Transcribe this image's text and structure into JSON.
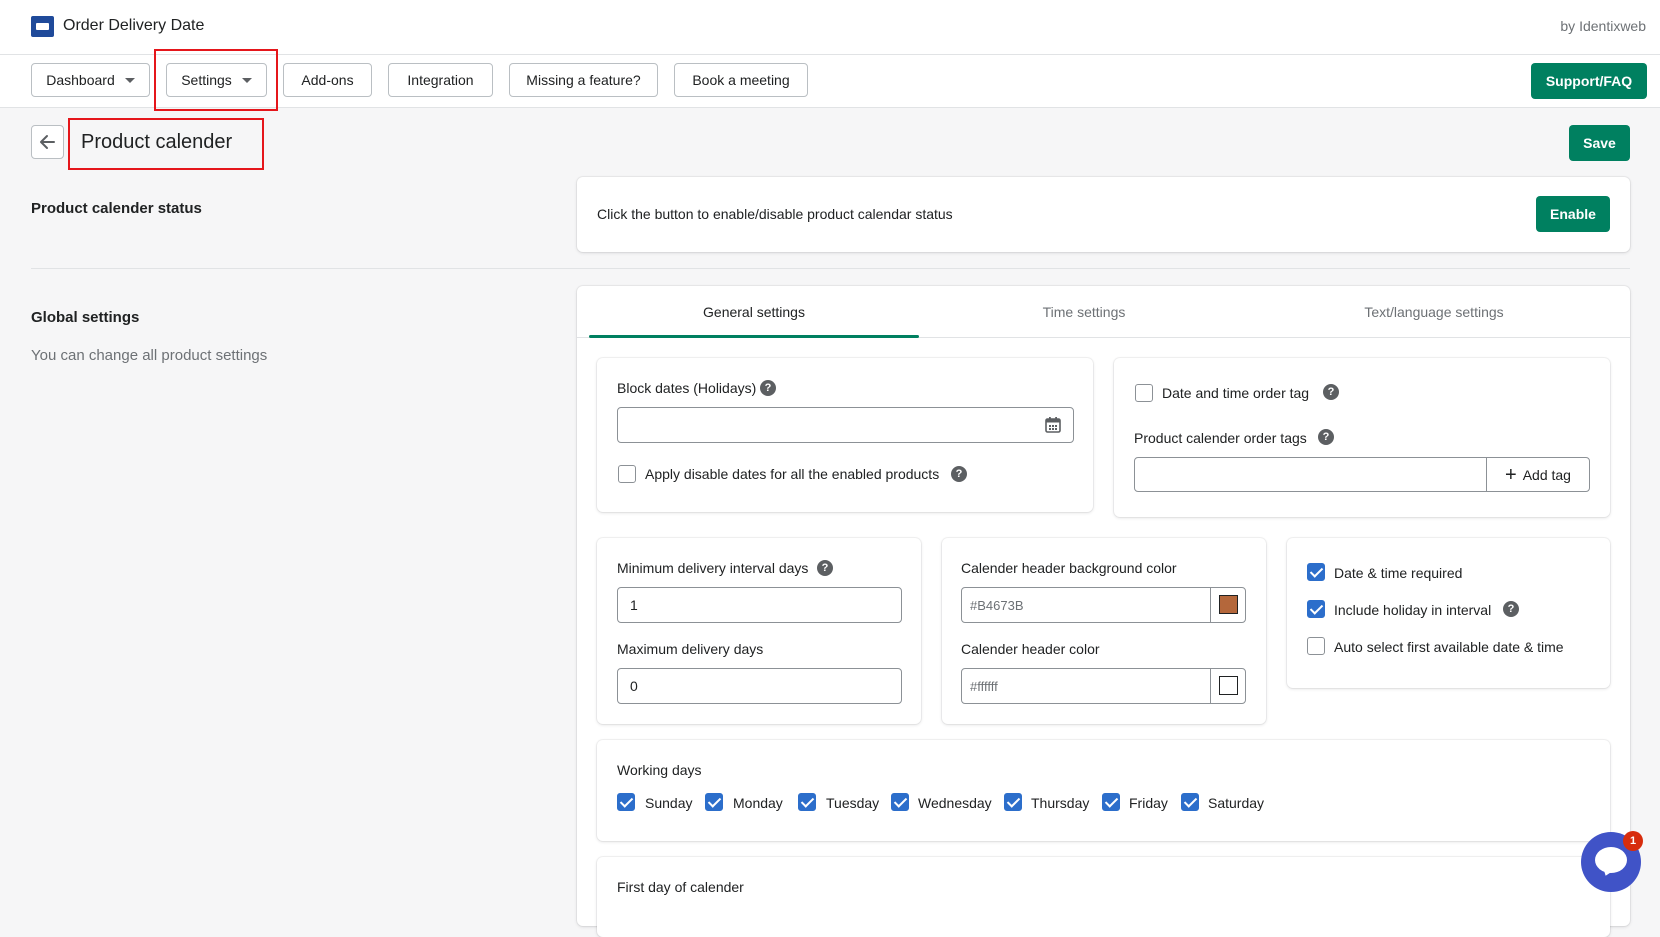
{
  "app": {
    "title": "Order Delivery Date",
    "byline": "by Identixweb"
  },
  "nav": {
    "dashboard": "Dashboard",
    "settings": "Settings",
    "addons": "Add-ons",
    "integration": "Integration",
    "missing_feature": "Missing a feature?",
    "book_meeting": "Book a meeting",
    "support": "Support/FAQ"
  },
  "page": {
    "title": "Product calender",
    "save": "Save"
  },
  "status_section": {
    "title": "Product calender status",
    "text": "Click the button to enable/disable product calendar status",
    "button": "Enable"
  },
  "global_section": {
    "title": "Global settings",
    "description": "You can change all product settings"
  },
  "tabs": [
    {
      "label": "General settings",
      "active": true
    },
    {
      "label": "Time settings",
      "active": false
    },
    {
      "label": "Text/language settings",
      "active": false
    }
  ],
  "block_dates": {
    "label": "Block dates (Holidays)",
    "value": "",
    "apply_label": "Apply disable dates for all the enabled products",
    "apply_checked": false
  },
  "order_tag": {
    "date_time_tag_label": "Date and time order tag",
    "date_time_tag_checked": false,
    "tags_label": "Product calender order tags",
    "tags_value": "",
    "add_tag": "Add tag"
  },
  "delivery": {
    "min_label": "Minimum delivery interval days",
    "min_value": "1",
    "max_label": "Maximum delivery days",
    "max_value": "0"
  },
  "colors": {
    "header_bg_label": "Calender header background color",
    "header_bg_value": "#B4673B",
    "header_color_label": "Calender header color",
    "header_color_value": "#ffffff"
  },
  "options": [
    {
      "label": "Date & time required",
      "checked": true
    },
    {
      "label": "Include holiday in interval",
      "checked": true
    },
    {
      "label": "Auto select first available date & time",
      "checked": false
    }
  ],
  "working_days": {
    "label": "Working days",
    "days": [
      "Sunday",
      "Monday",
      "Tuesday",
      "Wednesday",
      "Thursday",
      "Friday",
      "Saturday"
    ]
  },
  "first_day": {
    "label": "First day of calender"
  },
  "chat": {
    "badge": "1"
  },
  "ui_colors": {
    "accent": "#008060",
    "checkbox": "#2c6ecb",
    "highlight": "#e5161b",
    "chat": "#4053c7"
  },
  "icons": [
    "app-logo-icon",
    "caret-down-icon",
    "back-arrow-icon",
    "help-icon",
    "calendar-icon",
    "plus-icon",
    "chat-icon"
  ]
}
